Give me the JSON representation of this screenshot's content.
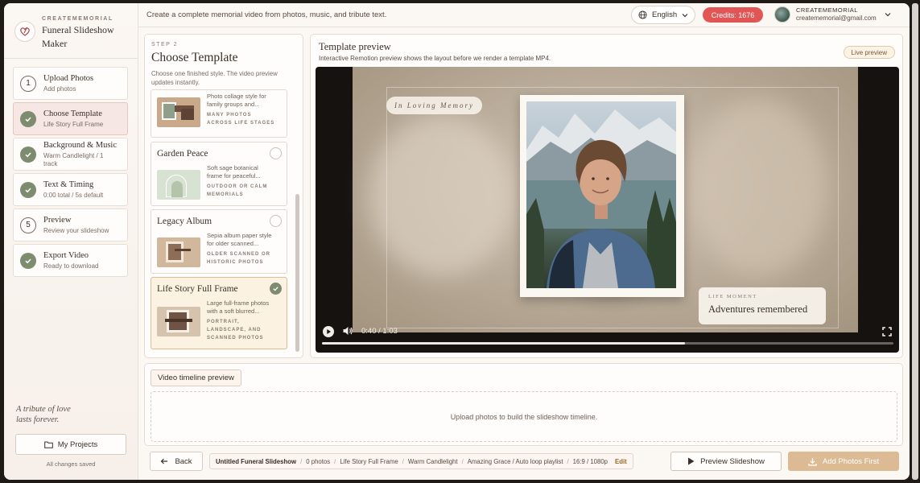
{
  "sidebar": {
    "brand_small": "CREATEMEMORIAL",
    "brand_title_1": "Funeral Slideshow",
    "brand_title_2": "Maker",
    "steps": [
      {
        "marker": "1",
        "title": "Upload Photos",
        "sub": "Add photos",
        "state": "pending"
      },
      {
        "marker": "check",
        "title": "Choose Template",
        "sub": "Life Story Full Frame",
        "state": "active"
      },
      {
        "marker": "check",
        "title": "Background & Music",
        "sub1": "Warm Candlelight / 1",
        "sub2": "track",
        "state": "done"
      },
      {
        "marker": "check",
        "title": "Text & Timing",
        "sub": "0:00 total / 5s default",
        "state": "done"
      },
      {
        "marker": "5",
        "title": "Preview",
        "sub": "Review your slideshow",
        "state": "pending"
      },
      {
        "marker": "check",
        "title": "Export Video",
        "sub": "Ready to download",
        "state": "done"
      }
    ],
    "tribute_1": "A tribute of love",
    "tribute_2": "lasts forever.",
    "my_projects": "My Projects",
    "saved": "All changes saved"
  },
  "topbar": {
    "tagline": "Create a complete memorial video from photos, music, and tribute text.",
    "language": "English",
    "credits": "Credits: 1676",
    "account_name": "CREATEMEMORIAL",
    "account_email": "creatememorial@gmail.com"
  },
  "template_panel": {
    "step_label": "STEP 2",
    "title": "Choose Template",
    "description": "Choose one finished style. The video preview updates instantly.",
    "cards": [
      {
        "name": "",
        "desc_1": "Photo collage style for",
        "desc_2": "family groups and...",
        "tag_1": "MANY PHOTOS",
        "tag_2": "ACROSS LIFE STAGES",
        "tag_3": "",
        "selected": false
      },
      {
        "name": "Garden Peace",
        "desc_1": "Soft sage botanical",
        "desc_2": "frame for peaceful...",
        "tag_1": "OUTDOOR OR CALM",
        "tag_2": "MEMORIALS",
        "tag_3": "",
        "selected": false
      },
      {
        "name": "Legacy Album",
        "desc_1": "Sepia album paper style",
        "desc_2": "for older scanned...",
        "tag_1": "OLDER SCANNED OR",
        "tag_2": "HISTORIC PHOTOS",
        "tag_3": "",
        "selected": false
      },
      {
        "name": "Life Story Full Frame",
        "desc_1": "Large full-frame photos",
        "desc_2": "with a soft blurred...",
        "tag_1": "PORTRAIT,",
        "tag_2": "LANDSCAPE, AND",
        "tag_3": "SCANNED PHOTOS",
        "selected": true
      }
    ]
  },
  "preview": {
    "title": "Template preview",
    "subtitle": "Interactive Remotion preview shows the layout before we render a template MP4.",
    "live_badge": "Live preview",
    "memory_pill": "In Loving Memory",
    "life_label": "LIFE MOMENT",
    "life_text": "Adventures remembered",
    "time": "0:40 / 1:03",
    "progress": 0.635
  },
  "timeline": {
    "button": "Video timeline preview",
    "empty": "Upload photos to build the slideshow timeline."
  },
  "bottombar": {
    "back": "Back",
    "summary_title": "Untitled Funeral Slideshow",
    "summary_photos": "0 photos",
    "summary_template": "Life Story Full Frame",
    "summary_bg": "Warm Candlelight",
    "summary_music": "Amazing Grace / Auto loop playlist",
    "summary_format": "16:9 / 1080p",
    "edit": "Edit",
    "preview_button": "Preview Slideshow",
    "add_button": "Add Photos First"
  }
}
